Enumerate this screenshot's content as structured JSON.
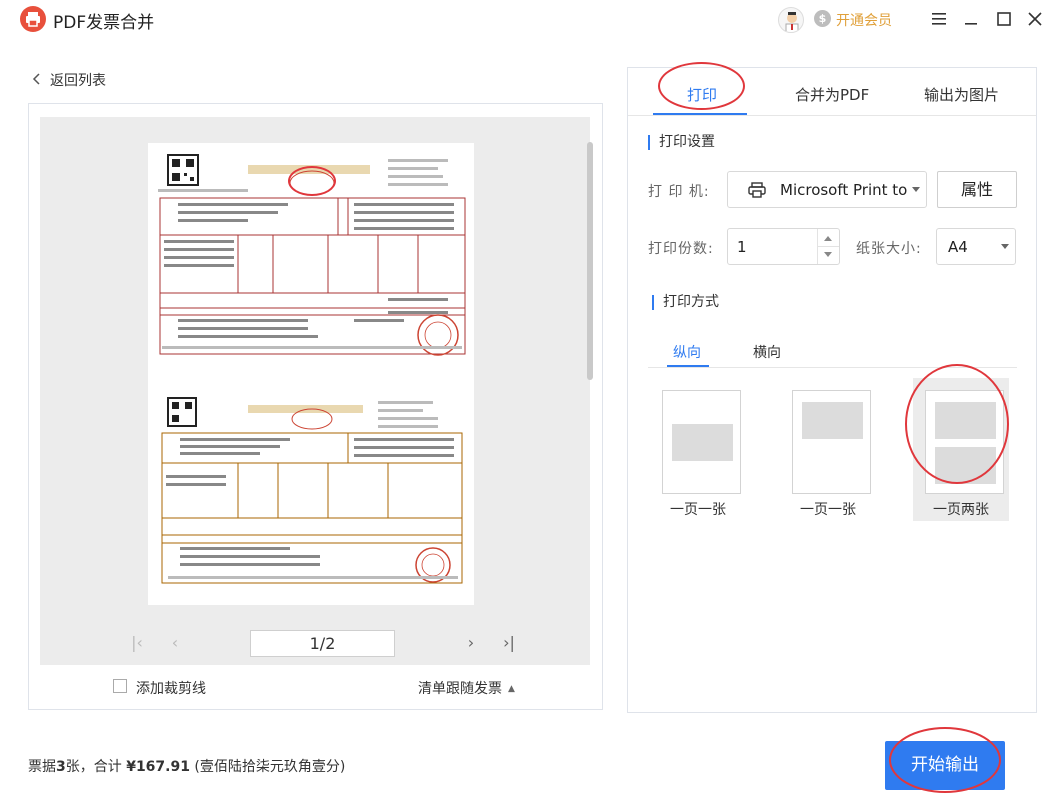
{
  "titlebar": {
    "app_title": "PDF发票合并",
    "vip_label": "开通会员",
    "vip_icon_glyph": "$"
  },
  "preview": {
    "back_label": "返回列表",
    "page_indicator": "1/2",
    "crop_lines_label": "添加裁剪线",
    "list_invoice_label": "清单跟随发票"
  },
  "panel": {
    "tabs": [
      {
        "label": "打印",
        "active": true
      },
      {
        "label": "合并为PDF",
        "active": false
      },
      {
        "label": "输出为图片",
        "active": false
      }
    ],
    "print_settings_title": "打印设置",
    "printer_label": "打 印 机:",
    "printer_value": "Microsoft Print to PDF",
    "properties_button": "属性",
    "copies_label": "打印份数:",
    "copies_value": "1",
    "paper_size_label": "纸张大小:",
    "paper_size_value": "A4",
    "print_mode_title": "打印方式",
    "orientation_tabs": [
      {
        "label": "纵向",
        "active": true
      },
      {
        "label": "横向",
        "active": false
      }
    ],
    "layouts": [
      {
        "label": "一页一张",
        "selected": false
      },
      {
        "label": "一页一张",
        "selected": false
      },
      {
        "label": "一页两张",
        "selected": true
      }
    ]
  },
  "footer": {
    "summary_prefix": "票据",
    "count": "3",
    "summary_mid": "张，合计",
    "total": "¥167.91",
    "total_words": "(壹佰陆拾柒元玖角壹分)",
    "start_button": "开始输出"
  },
  "colors": {
    "accent": "#2f7bf0",
    "annotation": "#e0373c",
    "vip": "#e0a03a",
    "logo": "#e8503c"
  }
}
